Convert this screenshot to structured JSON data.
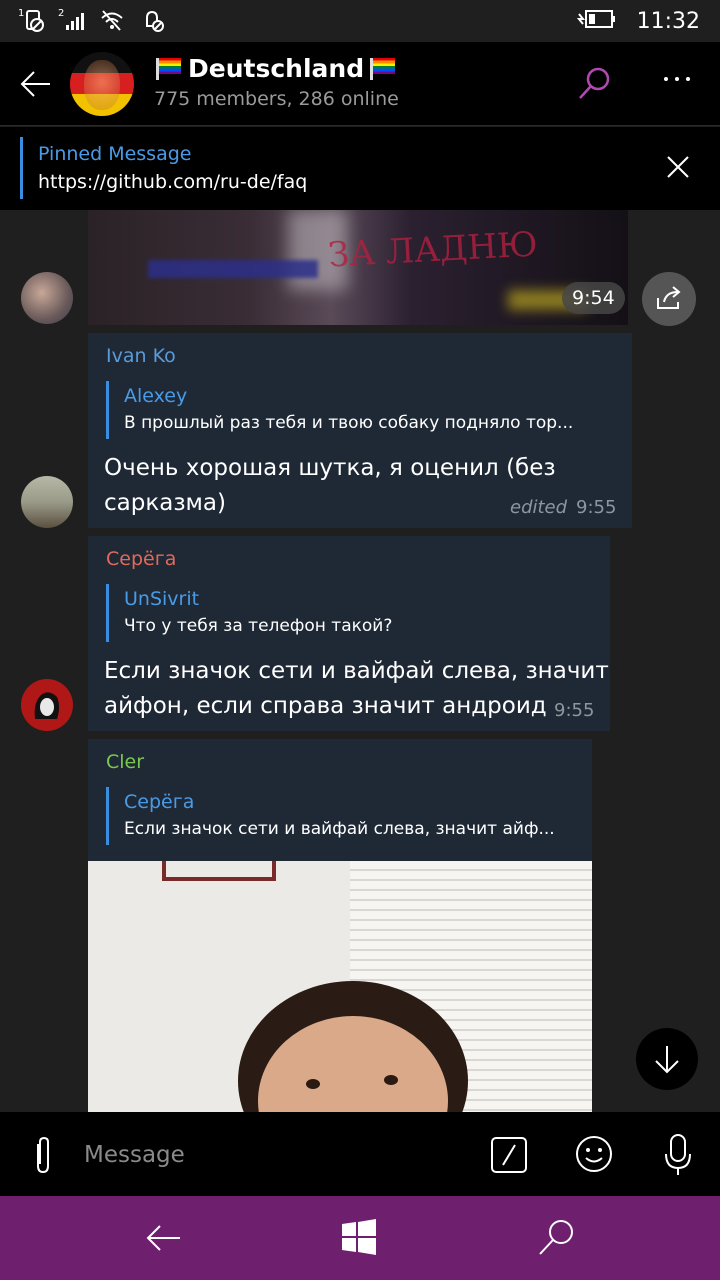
{
  "status_bar": {
    "time": "11:32",
    "sim1_label": "1",
    "sim2_label": "2"
  },
  "header": {
    "title": "Deutschland",
    "subtitle": "775 members, 286 online"
  },
  "pinned": {
    "title": "Pinned Message",
    "text": "https://github.com/ru-de/faq"
  },
  "messages": [
    {
      "type": "media",
      "time": "9:54",
      "media_caption": "ЗА ЛАДНЮ"
    },
    {
      "type": "text",
      "sender": "Ivan Ko",
      "sender_color": "#5a9bd8",
      "reply_name": "Alexey",
      "reply_text": "В прошлый раз тебя и твою собаку подняло тор...",
      "text_line1": "Очень хорошая шутка, я оценил (без",
      "text_line2": "сарказма)",
      "edited": "edited",
      "time": "9:55"
    },
    {
      "type": "text",
      "sender": "Серёга",
      "sender_color": "#e06a5a",
      "reply_name": "UnSivrit",
      "reply_text": "Что у тебя за телефон такой?",
      "text_line1": "Если значок сети и вайфай слева, значит",
      "text_line2": "айфон, если справа значит андроид",
      "time": "9:55"
    },
    {
      "type": "photo",
      "sender": "Cler",
      "sender_color": "#7ac74f",
      "reply_name": "Серёга",
      "reply_text": "Если значок сети и вайфай слева, значит айф..."
    }
  ],
  "input": {
    "placeholder": "Message"
  },
  "colors": {
    "accent": "#4a9be6",
    "search_accent": "#b04ab0",
    "nav_bar": "#6e1f6e",
    "bubble": "#1f2936"
  },
  "icons": [
    "back-arrow-icon",
    "search-icon",
    "more-icon",
    "close-icon",
    "share-icon",
    "scroll-down-icon",
    "attach-icon",
    "command-icon",
    "emoji-icon",
    "microphone-icon",
    "windows-icon"
  ]
}
